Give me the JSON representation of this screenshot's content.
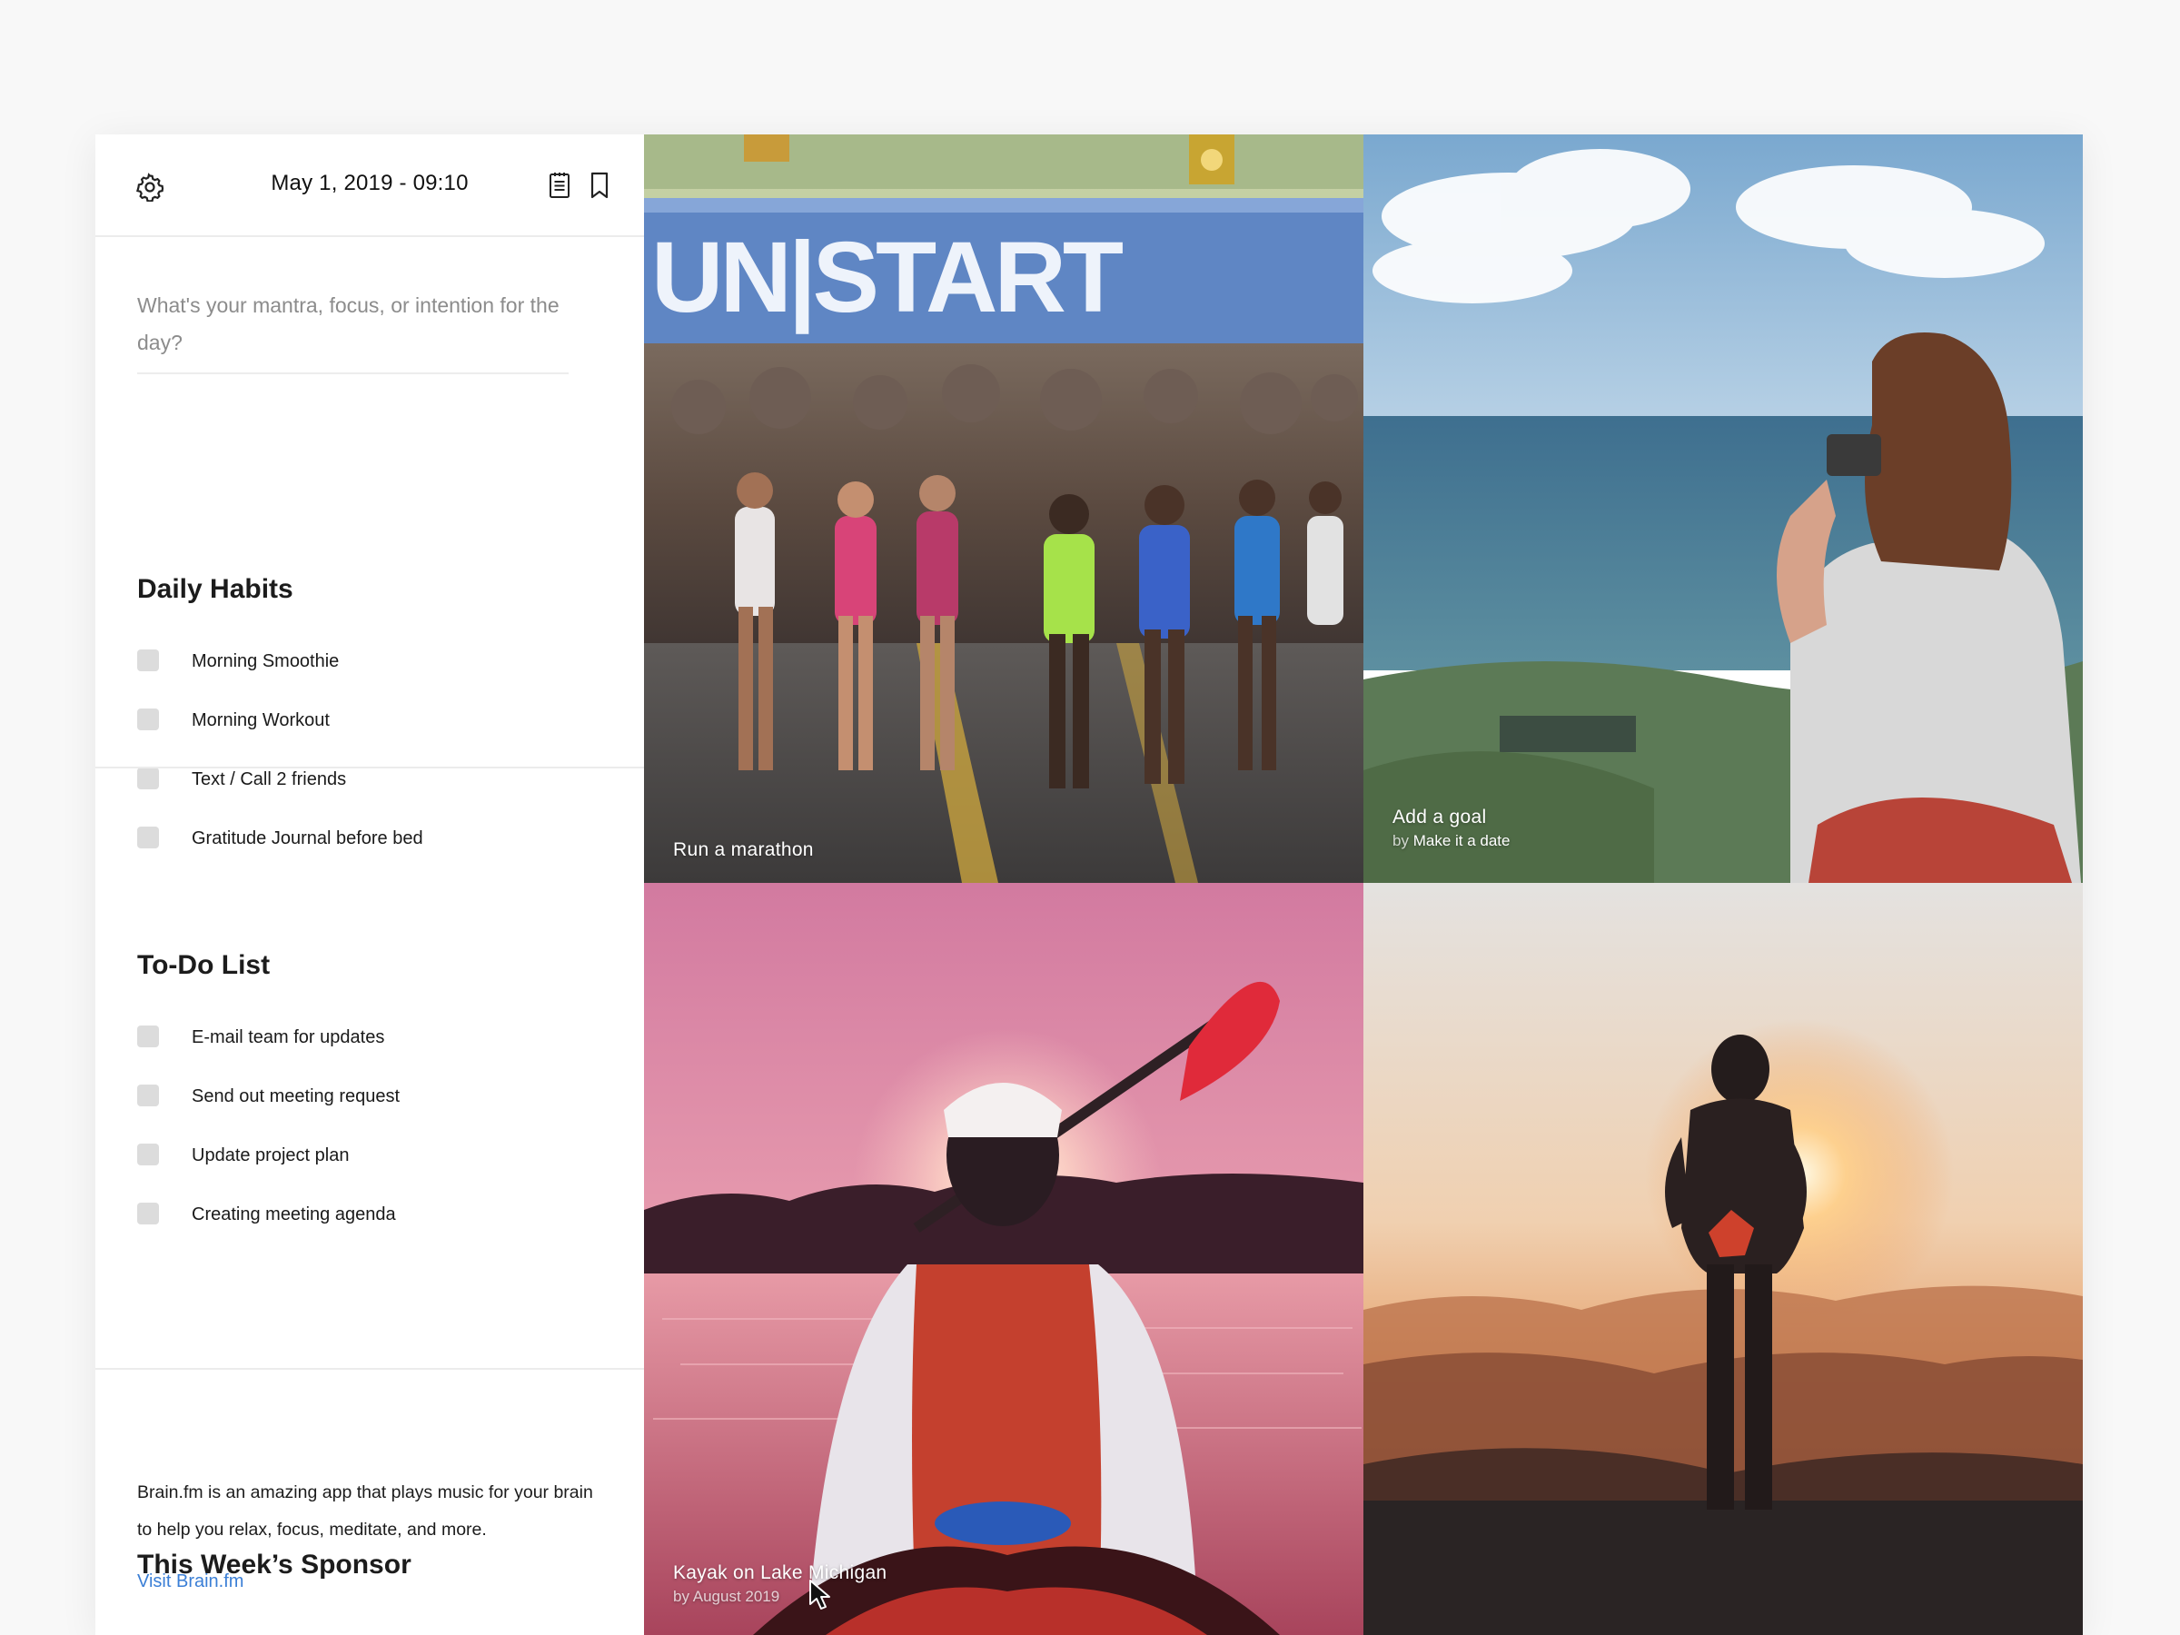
{
  "header": {
    "datetime": "May 1, 2019 - 09:10",
    "icons": [
      "settings-gear-icon",
      "journal-icon",
      "bookmark-icon"
    ]
  },
  "mantra": {
    "placeholder": "What's your mantra, focus, or intention for the day?"
  },
  "habits": {
    "title": "Daily Habits",
    "items": [
      {
        "label": "Morning Smoothie",
        "checked": false
      },
      {
        "label": "Morning Workout",
        "checked": false
      },
      {
        "label": "Text / Call 2 friends",
        "checked": false
      },
      {
        "label": "Gratitude Journal before bed",
        "checked": false
      }
    ]
  },
  "todo": {
    "title": "To-Do List",
    "items": [
      {
        "label": "E-mail team for updates",
        "checked": false
      },
      {
        "label": "Send out meeting request",
        "checked": false
      },
      {
        "label": "Update project plan",
        "checked": false
      },
      {
        "label": "Creating meeting agenda",
        "checked": false
      }
    ]
  },
  "sponsor": {
    "title": "This Week’s Sponsor",
    "text": "Brain.fm is an amazing app that plays music for your brain to help you relax, focus, meditate, and more.",
    "link": "Visit Brain.fm"
  },
  "tiles": [
    {
      "title": "Run a marathon",
      "image": "marathon-start-photo"
    },
    {
      "title": "Add a goal",
      "by_prefix": "by",
      "by": "Make it a date",
      "image": "woman-photographing-sea-photo"
    },
    {
      "title": "Kayak on Lake Michigan",
      "by": "by August 2019",
      "image": "kayak-sunset-photo"
    },
    {
      "title": "",
      "image": "hiker-sunset-photo"
    }
  ],
  "colors": {
    "accent_link": "#3b7fd6",
    "checkbox": "#dcdcdc",
    "placeholder": "#8c8c8c"
  }
}
